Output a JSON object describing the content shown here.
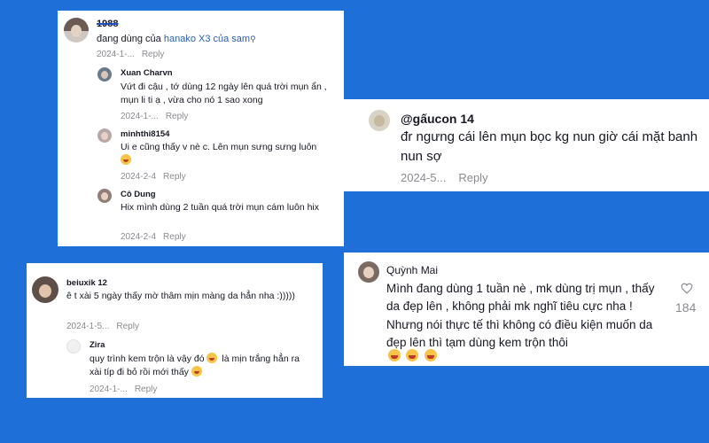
{
  "card1": {
    "comment": {
      "username": "1988",
      "text_prefix": "đang dùng của ",
      "text_link": "hanako X3 của sam",
      "date": "2024-1-...",
      "reply_label": "Reply"
    },
    "replies": [
      {
        "username": "Xuan Charvn",
        "text": "Vứt đi cậu , tớ dùng 12 ngày lên quá trời mụn ẩn , mụn li ti ạ , vừa cho nó 1 sao xong",
        "date": "2024-1-...",
        "reply_label": "Reply"
      },
      {
        "username": "minhthi8154",
        "text": "Ui e cũng thấy v nè c. Lên mụn sưng sưng luôn",
        "date": "2024-2-4",
        "reply_label": "Reply"
      },
      {
        "username": "Cô Dung",
        "text": "Hix mình dùng 2 tuần quá trời mụn cám luôn hix",
        "date": "2024-2-4",
        "reply_label": "Reply"
      }
    ]
  },
  "card2": {
    "username": "@gấucon 14",
    "text": "đr ngưng cái lên mụn bọc kg nun giờ cái mặt banh nun sợ",
    "date": "2024-5...",
    "reply_label": "Reply"
  },
  "card3": {
    "comment": {
      "username": "beiuxik 12",
      "text": "ê t xài 5 ngày thấy mờ thâm mịn màng da hẳn nha :)))))",
      "date": "2024-1-5...",
      "reply_label": "Reply"
    },
    "reply": {
      "username": "Zira",
      "text": "quy trình kem trộn là vậy đó 😂 là mịn trắng hẳn ra xài típ đi bỏ rồi mới thấy 😂",
      "text_a": "quy trình kem trộn là vậy đó ",
      "text_b": " là mịn trắng hẳn ra xài típ đi bỏ rồi mới thấy ",
      "date": "2024-1-...",
      "reply_label": "Reply"
    }
  },
  "card4": {
    "username": "Quỳnh Mai",
    "text": "Mình đang dùng 1 tuần nè , mk dùng trị mụn , thấy da đẹp lên , không phải mk nghĩ tiêu cực nha ! Nhưng nói thực tế thì không có điều kiện muốn da đẹp lên thì tạm dùng kem trộn thôi",
    "likes": "184"
  },
  "colors": {
    "background": "#1f6fd8",
    "card": "#ffffff",
    "muted": "#8a8b91",
    "link": "#2b5eaa"
  },
  "icons": {
    "search": "search-icon",
    "heart": "heart-outline-icon",
    "emoji": "laughing-emoji-icon"
  }
}
